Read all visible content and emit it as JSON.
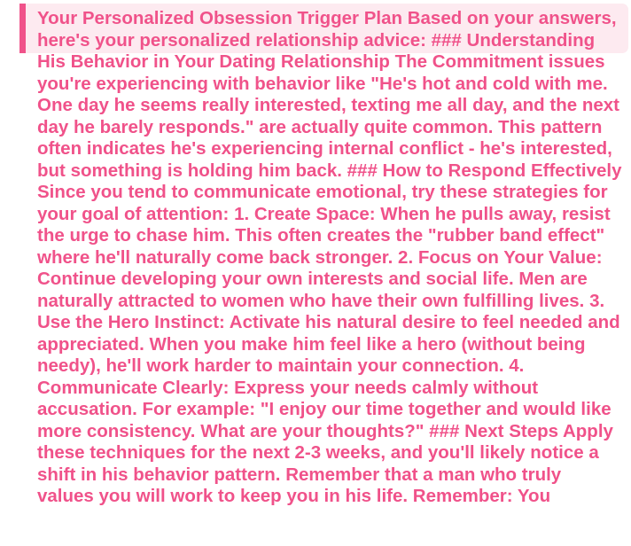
{
  "result": {
    "text": "Your Personalized Obsession Trigger Plan Based on your answers, here's your personalized relationship advice: ### Understanding His Behavior in Your Dating Relationship The Commitment issues you're experiencing with behavior like \"He's hot and cold with me. One day he seems really interested, texting me all day, and the next day he barely responds.\" are actually quite common. This pattern often indicates he's experiencing internal conflict - he's interested, but something is holding him back. ### How to Respond Effectively Since you tend to communicate emotional, try these strategies for your goal of attention: 1. Create Space: When he pulls away, resist the urge to chase him. This often creates the \"rubber band effect\" where he'll naturally come back stronger. 2. Focus on Your Value: Continue developing your own interests and social life. Men are naturally attracted to women who have their own fulfilling lives. 3. Use the Hero Instinct: Activate his natural desire to feel needed and appreciated. When you make him feel like a hero (without being needy), he'll work harder to maintain your connection. 4. Communicate Clearly: Express your needs calmly without accusation. For example: \"I enjoy our time together and would like more consistency. What are your thoughts?\" ### Next Steps Apply these techniques for the next 2-3 weeks, and you'll likely notice a shift in his behavior pattern. Remember that a man who truly values you will work to keep you in his life. Remember: You"
  },
  "colors": {
    "accent": "#f0528a",
    "box_background": "#fdeaf0"
  }
}
